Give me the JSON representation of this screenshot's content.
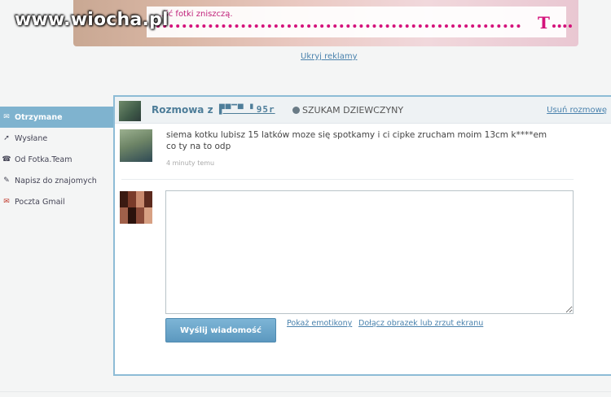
{
  "watermark": "www.wiocha.pl",
  "ad": {
    "text": "...ść fotki zniszczą.",
    "logo": "T",
    "hide_label": "Ukryj reklamy"
  },
  "sidebar": {
    "items": [
      {
        "label": "Otrzymane",
        "icon": "inbox-icon",
        "glyph": "✉",
        "active": true
      },
      {
        "label": "Wysłane",
        "icon": "sent-icon",
        "glyph": "➚",
        "active": false
      },
      {
        "label": "Od Fotka.Team",
        "icon": "team-icon",
        "glyph": "☎",
        "active": false
      },
      {
        "label": "Napisz do znajomych",
        "icon": "write-icon",
        "glyph": "✎",
        "active": false
      },
      {
        "label": "Poczta Gmail",
        "icon": "gmail-icon",
        "glyph": "✉",
        "active": false
      }
    ]
  },
  "conversation": {
    "title_prefix": "Rozmowa z",
    "user_name": "▛▀▔▀ ▘95r",
    "status": "SZUKAM DZIEWCZYNY",
    "delete_label": "Usuń rozmowę"
  },
  "message": {
    "text": "siema kotku lubisz 15 latków moze się spotkamy i ci cipke zrucham moim 13cm k****em co ty na to odp",
    "time": "4 minuty temu"
  },
  "reply": {
    "value": "",
    "send_label": "Wyślij wiadomość",
    "emoticons_label": "Pokaż emotikony",
    "attach_label": "Dołącz obrazek lub zrzut ekranu"
  },
  "colors": {
    "accent": "#7fb3cf",
    "link": "#4a82ad",
    "brand": "#d4127b"
  }
}
